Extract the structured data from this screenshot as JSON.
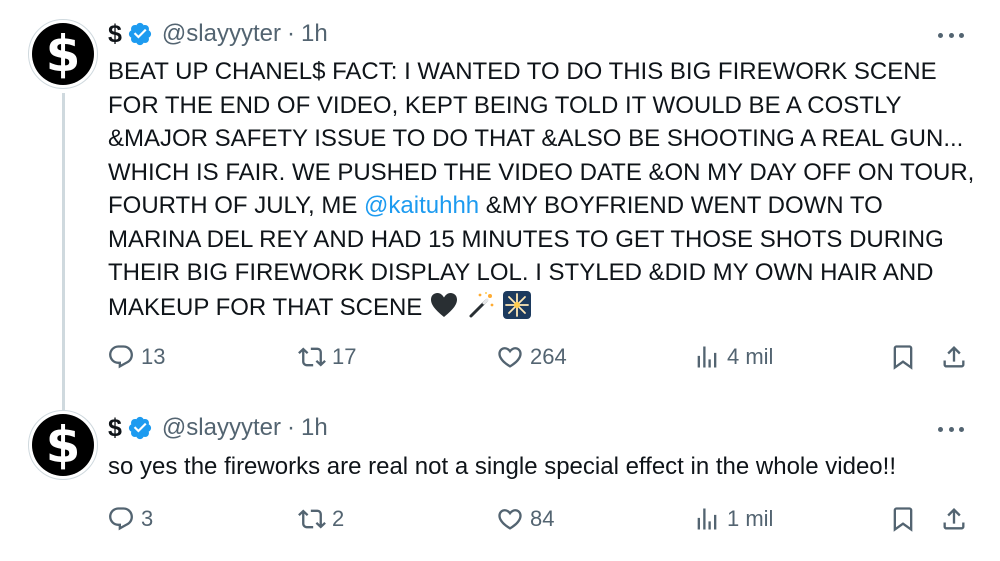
{
  "colors": {
    "text": "#0f1419",
    "muted": "#536471",
    "accent": "#1d9bf0",
    "divider": "#cfd9de"
  },
  "tweets": [
    {
      "avatar_icon": "dollar-sign-avatar",
      "avatar_glyph": "$",
      "name": "$",
      "verified_icon": "verified-badge-icon",
      "handle": "@slayyyter",
      "dot": "·",
      "time": "1h",
      "text_before": "BEAT UP CHANEL$ FACT: I WANTED TO DO THIS BIG FIREWORK SCENE\nFOR THE END OF VIDEO, KEPT BEING TOLD IT WOULD BE A COSTLY\n&MAJOR SAFETY ISSUE TO DO THAT  &ALSO BE SHOOTING A REAL GUN...\nWHICH IS FAIR. WE PUSHED THE VIDEO DATE &ON MY DAY OFF ON TOUR,\nFOURTH OF JULY, ME ",
      "mention": "@kaituhhh",
      "text_after": " &MY BOYFRIEND WENT DOWN TO\nMARINA DEL REY AND HAD 15 MINUTES TO GET THOSE SHOTS DURING\nTHEIR BIG FIREWORK DISPLAY LOL. I STYLED &DID MY OWN HAIR AND\nMAKEUP FOR THAT SCENE ",
      "emojis": [
        "black-heart-emoji",
        "magic-wand-emoji",
        "fireworks-emoji"
      ],
      "replies": "13",
      "reposts": "17",
      "likes": "264",
      "views": "4 mil"
    },
    {
      "avatar_icon": "dollar-sign-avatar",
      "avatar_glyph": "$",
      "name": "$",
      "verified_icon": "verified-badge-icon",
      "handle": "@slayyyter",
      "dot": "·",
      "time": "1h",
      "text": "so yes the fireworks are real not a single special effect in the whole video!!",
      "replies": "3",
      "reposts": "2",
      "likes": "84",
      "views": "1 mil"
    }
  ]
}
